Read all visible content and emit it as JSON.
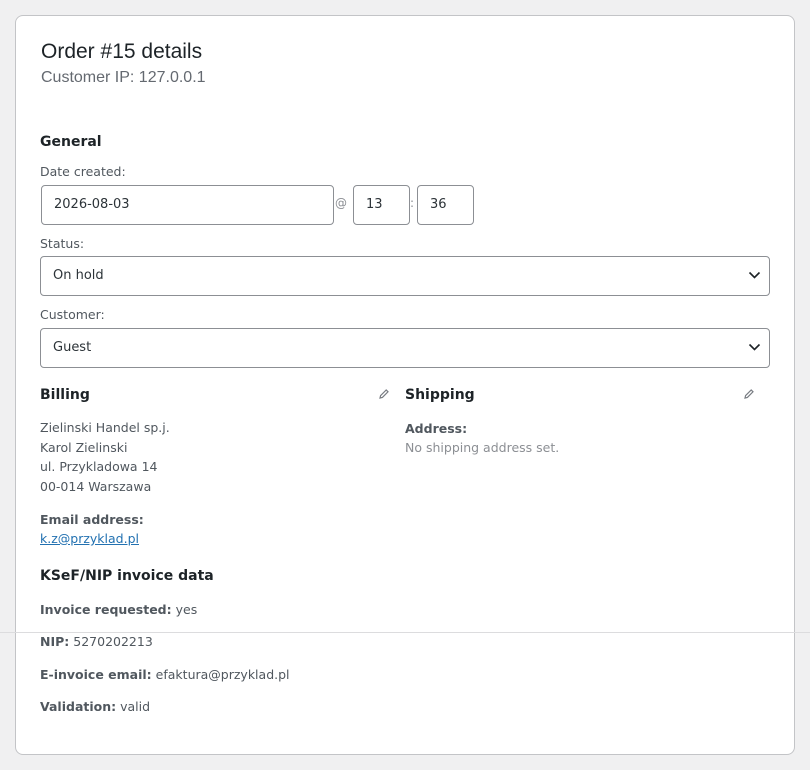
{
  "order": {
    "title": "Order #15 details",
    "customer_ip": "Customer IP: 127.0.0.1"
  },
  "general": {
    "heading": "General",
    "date_label": "Date created:",
    "date_value": "2026-08-03",
    "at": "@",
    "hour": "13",
    "colon": ":",
    "minute": "36",
    "status_label": "Status:",
    "status_value": "On hold",
    "customer_label": "Customer:",
    "customer_value": "Guest"
  },
  "billing": {
    "heading": "Billing",
    "address_lines": [
      "Zielinski Handel sp.j.",
      "Karol Zielinski",
      "ul. Przykladowa 14",
      "00-014 Warszawa"
    ],
    "email_label": "Email address:",
    "email": "k.z@przyklad.pl"
  },
  "shipping": {
    "heading": "Shipping",
    "address_label": "Address:",
    "address_value": "No shipping address set."
  },
  "ksef": {
    "heading": "KSeF/NIP invoice data",
    "invoice_requested_label": "Invoice requested:",
    "invoice_requested_value": "yes",
    "nip_label": "NIP:",
    "nip_value": "5270202213",
    "einvoice_label": "E-invoice email:",
    "einvoice_value": "efaktura@przyklad.pl",
    "validation_label": "Validation:",
    "validation_value": "valid"
  },
  "icons": {
    "edit": "pencil-icon",
    "dropdown": "chevron-down-icon"
  },
  "colors": {
    "link": "#2271b1",
    "page_bg": "#f0f0f1"
  }
}
